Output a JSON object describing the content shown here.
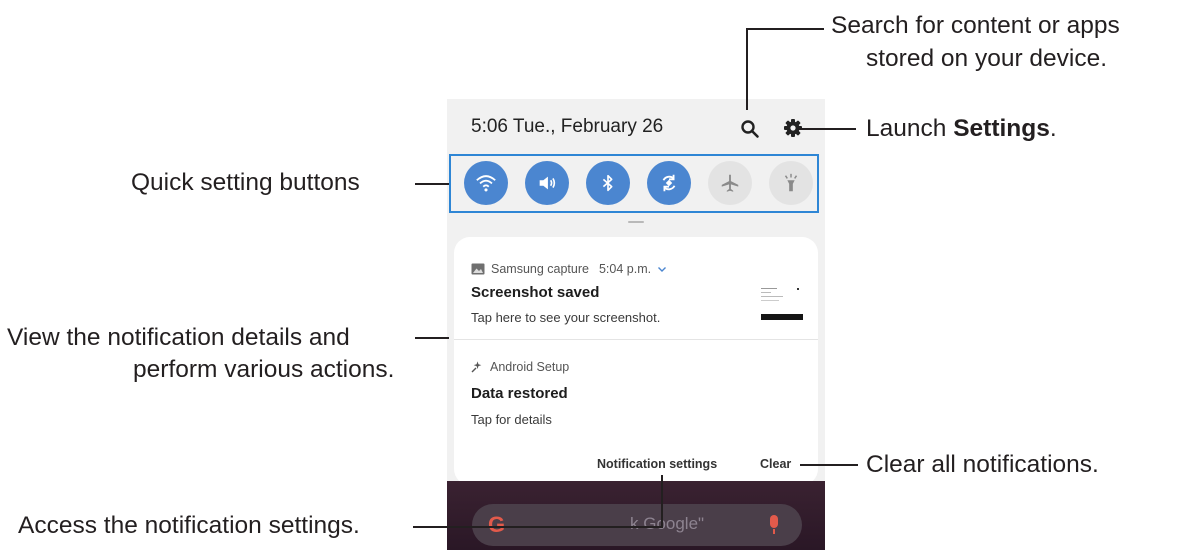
{
  "status_bar": {
    "time_date": "5:06  Tue., February 26"
  },
  "quick_settings": [
    {
      "name": "wifi",
      "icon": "wifi-icon",
      "active": true
    },
    {
      "name": "sound",
      "icon": "sound-icon",
      "active": true
    },
    {
      "name": "bluetooth",
      "icon": "bluetooth-icon",
      "active": true
    },
    {
      "name": "auto-rotate",
      "icon": "auto-rotate-icon",
      "active": true
    },
    {
      "name": "airplane-mode",
      "icon": "airplane-icon",
      "active": false
    },
    {
      "name": "flashlight",
      "icon": "flashlight-icon",
      "active": false
    }
  ],
  "notifications": [
    {
      "app": "Samsung capture",
      "time": "5:04 p.m.",
      "title": "Screenshot saved",
      "text": "Tap here to see your screenshot."
    },
    {
      "app": "Android Setup",
      "title": "Data restored",
      "text": "Tap for details"
    }
  ],
  "card_actions": {
    "notification_settings": "Notification settings",
    "clear": "Clear"
  },
  "google_bar": {
    "logo": "G",
    "text": "k Google\""
  },
  "callouts": {
    "search": {
      "line1": "Search for content or apps",
      "line2": "stored on your device."
    },
    "settings": {
      "prefix": "Launch ",
      "bold": "Settings",
      "suffix": "."
    },
    "quick_settings": "Quick setting buttons",
    "notification_details": {
      "line1": "View the notification details and",
      "line2": "perform various actions."
    },
    "clear_all": "Clear all notifications.",
    "notification_settings": "Access the notification settings."
  },
  "colors": {
    "accent_blue": "#4b86d0",
    "highlight_border": "#2e86d5",
    "callout_text": "#231f20"
  }
}
